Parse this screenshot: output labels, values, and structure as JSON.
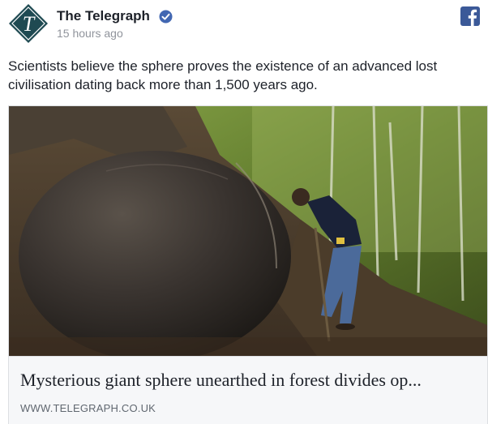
{
  "post": {
    "page_name": "The Telegraph",
    "timestamp": "15 hours ago",
    "avatar_letter": "T",
    "caption": "Scientists believe the sphere proves the existence of an advanced lost civilisation dating back more than 1,500 years ago.",
    "icons": {
      "avatar": "telegraph-logo-icon",
      "verified": "verified-badge-icon",
      "network": "facebook-icon"
    }
  },
  "link_card": {
    "headline": "Mysterious giant sphere unearthed in forest divides op...",
    "domain": "WWW.TELEGRAPH.CO.UK"
  },
  "colors": {
    "brand_teal": "#1f4a52",
    "verified_blue": "#4267b2",
    "facebook_blue": "#3b5998"
  }
}
